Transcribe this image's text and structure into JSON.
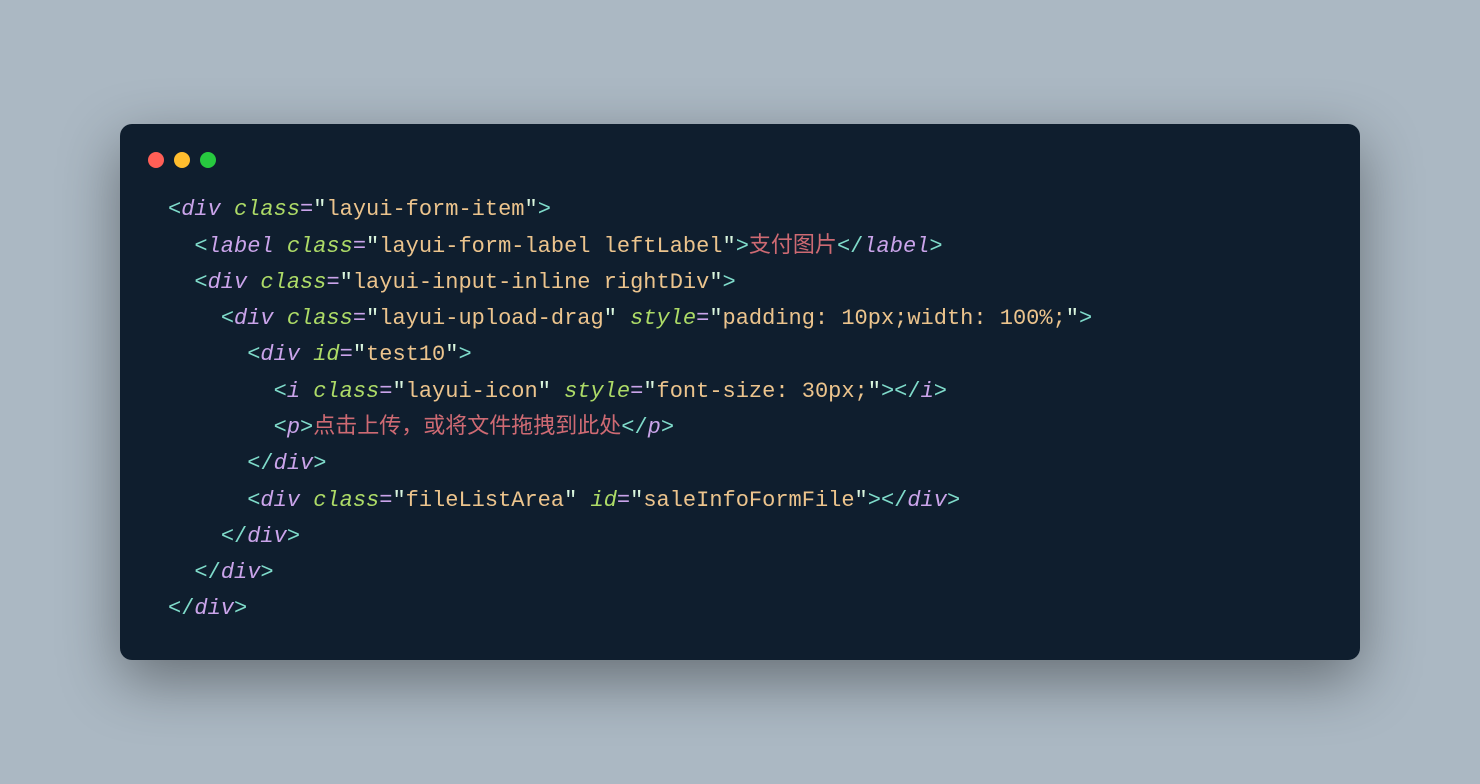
{
  "code": {
    "lines": [
      {
        "indent": 0,
        "type": "open",
        "tag": "div",
        "attrs": [
          [
            "class",
            "layui-form-item"
          ]
        ]
      },
      {
        "indent": 1,
        "type": "full",
        "tag": "label",
        "attrs": [
          [
            "class",
            "layui-form-label leftLabel"
          ]
        ],
        "text": "支付图片"
      },
      {
        "indent": 1,
        "type": "open",
        "tag": "div",
        "attrs": [
          [
            "class",
            "layui-input-inline rightDiv"
          ]
        ]
      },
      {
        "indent": 2,
        "type": "open",
        "tag": "div",
        "attrs": [
          [
            "class",
            "layui-upload-drag"
          ],
          [
            "style",
            "padding: 10px;width: 100%;"
          ]
        ]
      },
      {
        "indent": 3,
        "type": "open",
        "tag": "div",
        "attrs": [
          [
            "id",
            "test10"
          ]
        ]
      },
      {
        "indent": 4,
        "type": "full",
        "tag": "i",
        "attrs": [
          [
            "class",
            "layui-icon"
          ],
          [
            "style",
            "font-size: 30px;"
          ]
        ],
        "text": "",
        "glyph": true
      },
      {
        "indent": 4,
        "type": "full",
        "tag": "p",
        "attrs": [],
        "text": "点击上传，或将文件拖拽到此处"
      },
      {
        "indent": 3,
        "type": "close",
        "tag": "div"
      },
      {
        "indent": 3,
        "type": "full",
        "tag": "div",
        "attrs": [
          [
            "class",
            "fileListArea"
          ],
          [
            "id",
            "saleInfoFormFile"
          ]
        ],
        "text": ""
      },
      {
        "indent": 2,
        "type": "close",
        "tag": "div"
      },
      {
        "indent": 1,
        "type": "close",
        "tag": "div"
      },
      {
        "indent": 0,
        "type": "close",
        "tag": "div"
      }
    ]
  },
  "window": {
    "dots": [
      "red",
      "yellow",
      "green"
    ]
  }
}
